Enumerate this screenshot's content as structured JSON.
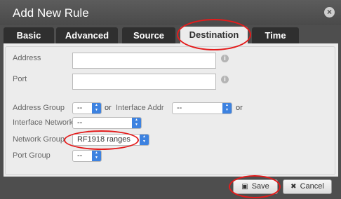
{
  "dialog": {
    "title": "Add New Rule",
    "close_icon": "close-icon"
  },
  "tabs": [
    {
      "label": "Basic",
      "active": false
    },
    {
      "label": "Advanced",
      "active": false
    },
    {
      "label": "Source",
      "active": false
    },
    {
      "label": "Destination",
      "active": true
    },
    {
      "label": "Time",
      "active": false
    }
  ],
  "form": {
    "address": {
      "label": "Address",
      "value": "",
      "info_icon": "info-icon"
    },
    "port": {
      "label": "Port",
      "value": "",
      "info_icon": "info-icon"
    },
    "address_group": {
      "label": "Address Group",
      "value": "--"
    },
    "or_1": "or",
    "interface_addr": {
      "label": "Interface Addr",
      "value": "--"
    },
    "or_2": "or",
    "interface_network": {
      "label": "Interface Network",
      "value": "--"
    },
    "network_group": {
      "label": "Network Group",
      "value": "RF1918 ranges"
    },
    "port_group": {
      "label": "Port Group",
      "value": "--"
    }
  },
  "footer": {
    "save_label": "Save",
    "save_icon": "floppy-disk-icon",
    "cancel_label": "Cancel",
    "cancel_icon": "x-icon"
  },
  "colors": {
    "accent": "#3d82e0",
    "highlight": "#e41b1b",
    "titlebar": "#4e4e4e"
  }
}
